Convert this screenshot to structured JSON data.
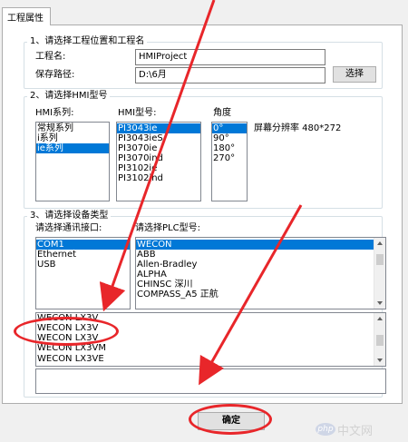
{
  "tab": {
    "label": "工程属性"
  },
  "section1": {
    "title": "1、请选择工程位置和工程名",
    "project_name_label": "工程名:",
    "project_name_value": "HMIProject",
    "save_path_label": "保存路径:",
    "save_path_value": "D:\\6月",
    "browse_button": "选择"
  },
  "section2": {
    "title": "2、请选择HMI型号",
    "series_label": "HMI系列:",
    "series_items": [
      "常规系列",
      "i系列",
      "ie系列"
    ],
    "model_label": "HMI型号:",
    "model_items": [
      "PI3043ie",
      "PI3043ieS",
      "PI3070ie",
      "PI3070ind",
      "PI3102ie",
      "PI3102ind"
    ],
    "angle_label": "角度",
    "angle_items": [
      "0°",
      "90°",
      "180°",
      "270°"
    ],
    "resolution_label": "屏幕分辨率 480*272"
  },
  "section3": {
    "title": "3、请选择设备类型",
    "port_label": "请选择通讯接口:",
    "port_items": [
      "COM1",
      "Ethernet",
      "USB"
    ],
    "plc_label": "请选择PLC型号:",
    "plc_items": [
      "WECON",
      "ABB",
      "Allen-Bradley",
      "ALPHA",
      "CHINSC 深川",
      "COMPASS_A5 正航"
    ],
    "submodel_items": [
      "WECON LX3V",
      "WECON LX3V",
      "WECON LX3V",
      "WECON LX3VM",
      "WECON LX3VE"
    ]
  },
  "footer": {
    "ok_button": "确定"
  },
  "watermark": {
    "text": "中文网",
    "badge": "php"
  },
  "colors": {
    "selection": "#0078d7",
    "annotation": "#e8262a"
  }
}
